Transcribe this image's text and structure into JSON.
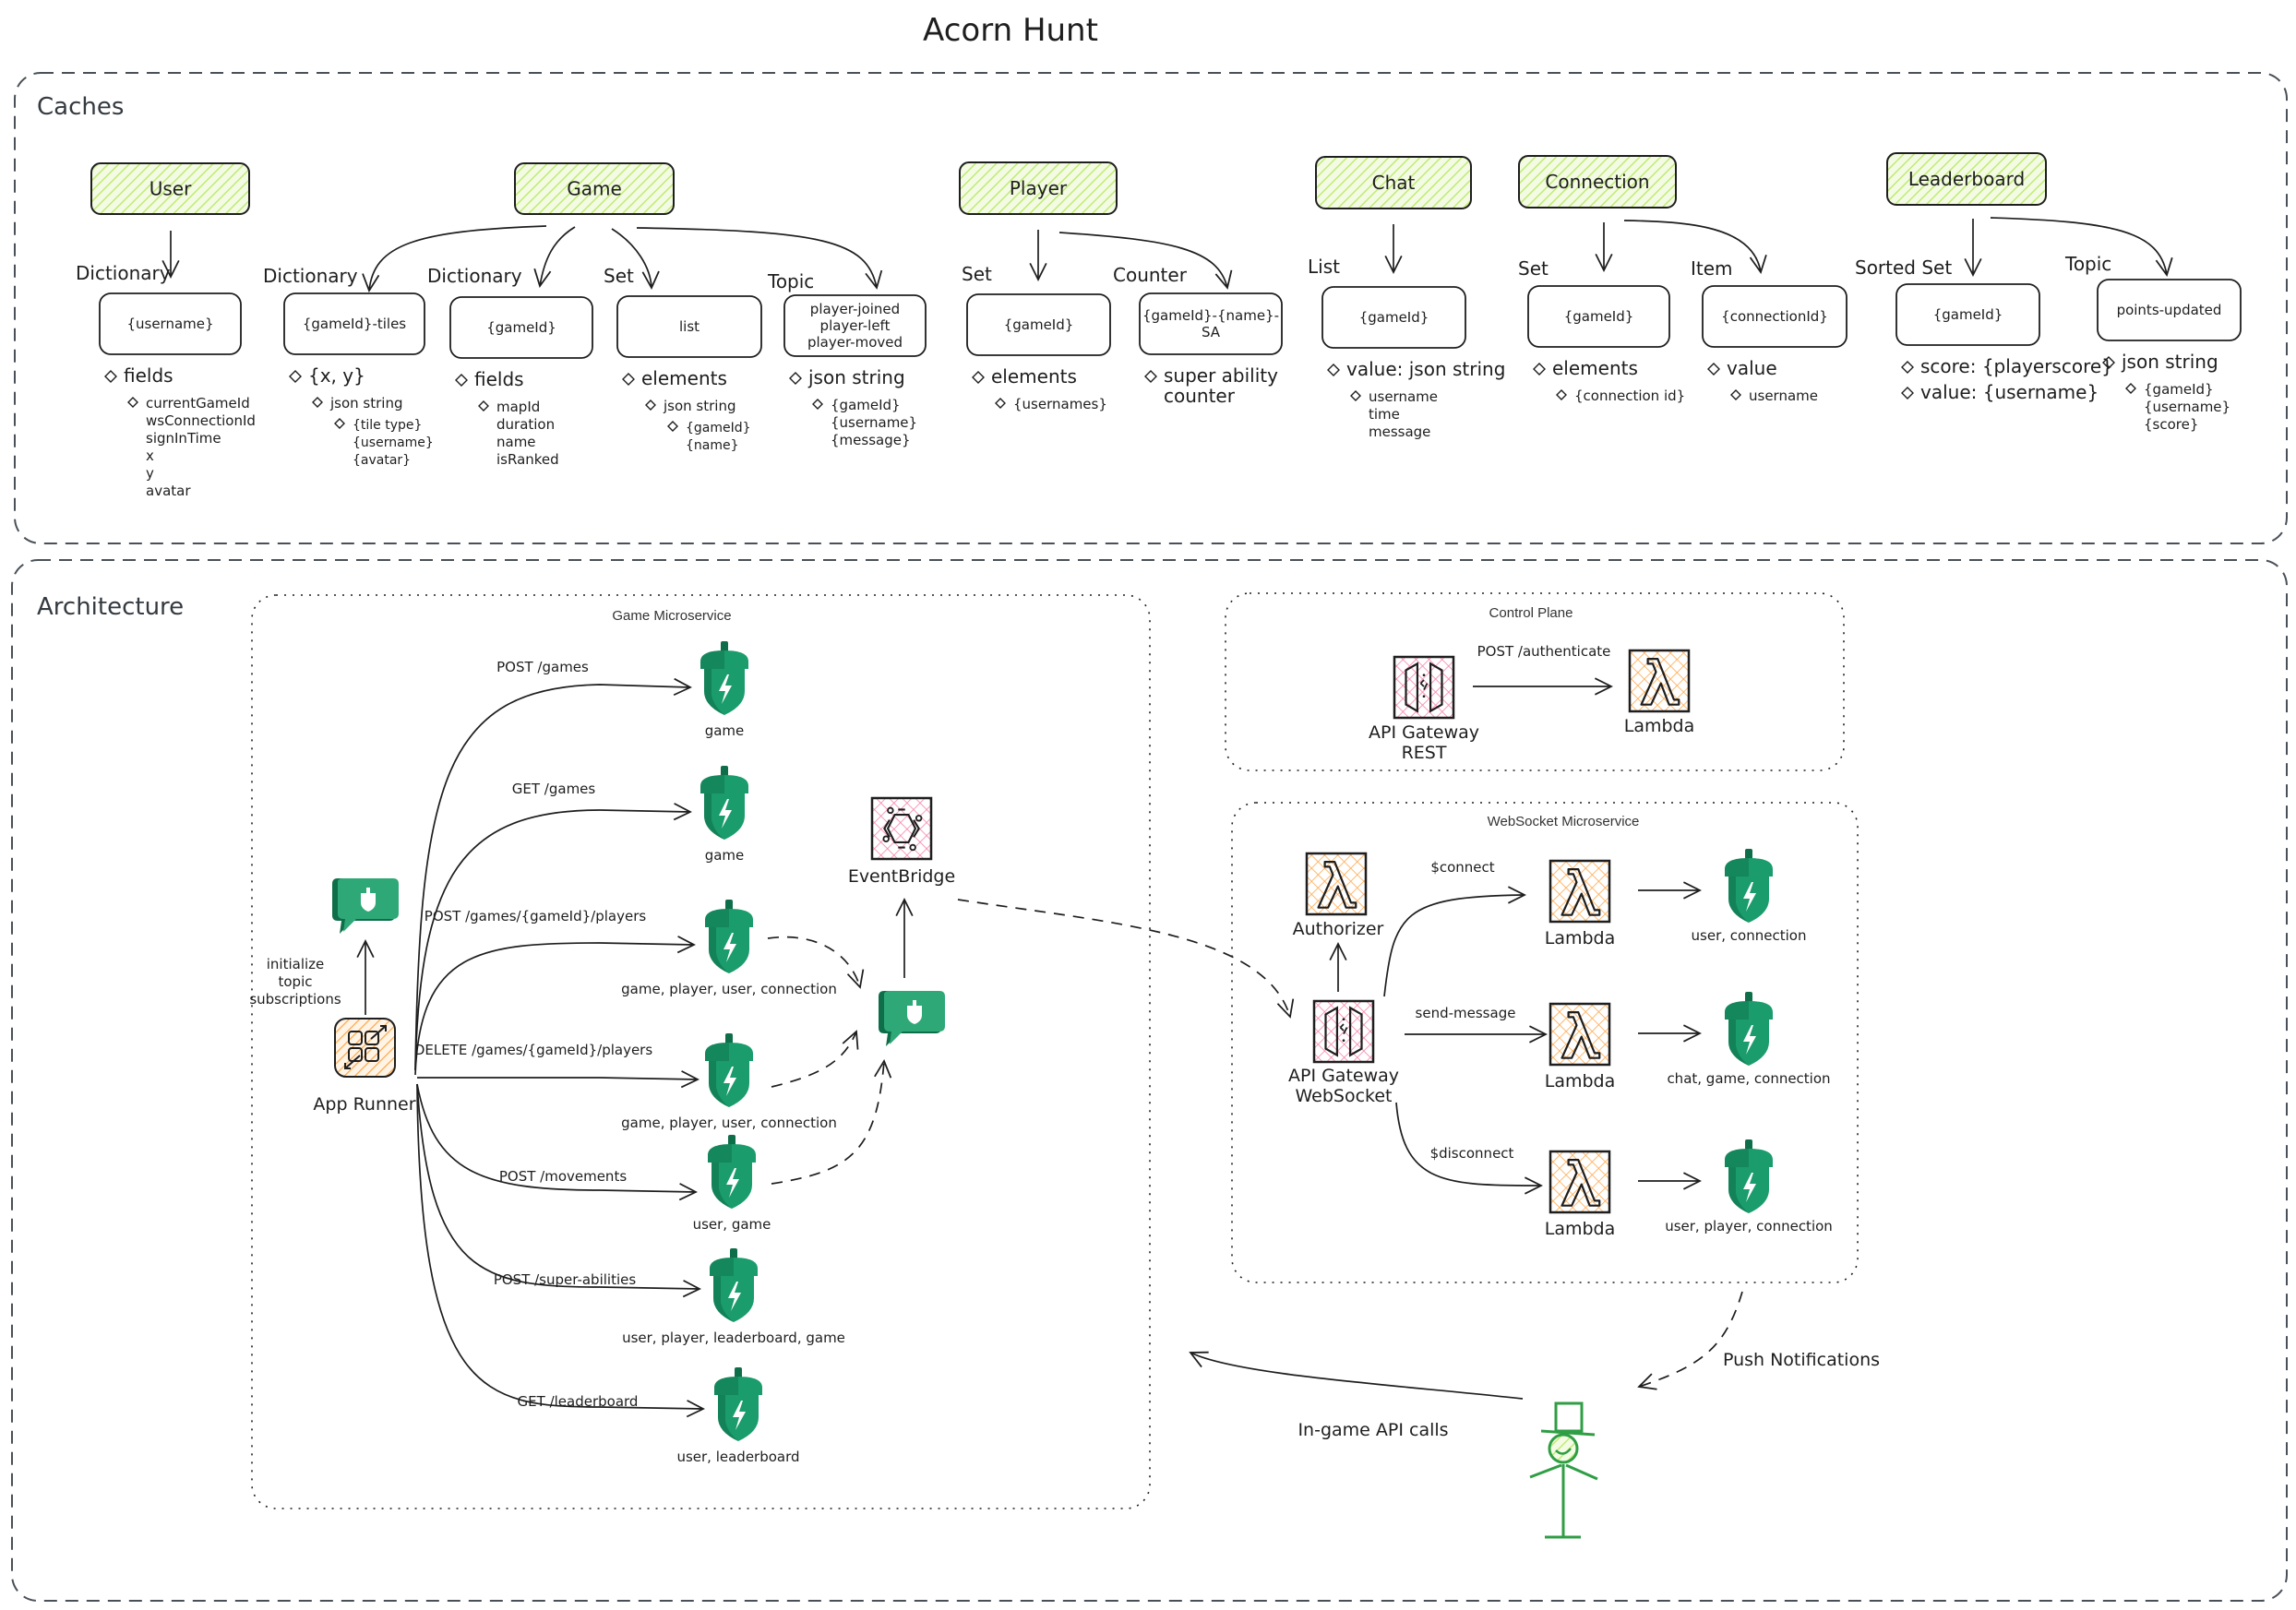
{
  "title": "Acorn Hunt",
  "caches": {
    "label": "Caches",
    "entities": [
      {
        "name": "User",
        "children": [
          {
            "type": "Dictionary",
            "key": "{username}",
            "bullets": [
              {
                "level": 1,
                "lines": [
                  "fields"
                ]
              },
              {
                "level": 2,
                "lines": [
                  "currentGameId",
                  "wsConnectionId",
                  "signInTime",
                  "x",
                  "y",
                  "avatar"
                ]
              }
            ]
          }
        ]
      },
      {
        "name": "Game",
        "children": [
          {
            "type": "Dictionary",
            "key": "{gameId}-tiles",
            "bullets": [
              {
                "level": 1,
                "lines": [
                  "{x, y}"
                ]
              },
              {
                "level": 2,
                "lines": [
                  "json string"
                ]
              },
              {
                "level": 3,
                "lines": [
                  "{tile type}",
                  "{username}",
                  "{avatar}"
                ]
              }
            ]
          },
          {
            "type": "Dictionary",
            "key": "{gameId}",
            "bullets": [
              {
                "level": 1,
                "lines": [
                  "fields"
                ]
              },
              {
                "level": 2,
                "lines": [
                  "mapId",
                  "duration",
                  "name",
                  "isRanked"
                ]
              }
            ]
          },
          {
            "type": "Set",
            "key": "list",
            "bullets": [
              {
                "level": 1,
                "lines": [
                  "elements"
                ]
              },
              {
                "level": 2,
                "lines": [
                  "json string"
                ]
              },
              {
                "level": 3,
                "lines": [
                  "{gameId}",
                  "{name}"
                ]
              }
            ]
          },
          {
            "type": "Topic",
            "key": "player-joined\nplayer-left\nplayer-moved",
            "bullets": [
              {
                "level": 1,
                "lines": [
                  "json string"
                ]
              },
              {
                "level": 2,
                "lines": [
                  "{gameId}",
                  "{username}",
                  "{message}"
                ]
              }
            ]
          }
        ]
      },
      {
        "name": "Player",
        "children": [
          {
            "type": "Set",
            "key": "{gameId}",
            "bullets": [
              {
                "level": 1,
                "lines": [
                  "elements"
                ]
              },
              {
                "level": 2,
                "lines": [
                  "{usernames}"
                ]
              }
            ]
          },
          {
            "type": "Counter",
            "key": "{gameId}-{name}-\nSA",
            "bullets": [
              {
                "level": 1,
                "lines": [
                  "super ability",
                  "counter"
                ]
              }
            ]
          }
        ]
      },
      {
        "name": "Chat",
        "children": [
          {
            "type": "List",
            "key": "{gameId}",
            "bullets": [
              {
                "level": 1,
                "lines": [
                  "value: json string"
                ]
              },
              {
                "level": 2,
                "lines": [
                  "username",
                  "time",
                  "message"
                ]
              }
            ]
          }
        ]
      },
      {
        "name": "Connection",
        "children": [
          {
            "type": "Set",
            "key": "{gameId}",
            "bullets": [
              {
                "level": 1,
                "lines": [
                  "elements"
                ]
              },
              {
                "level": 2,
                "lines": [
                  "{connection id}"
                ]
              }
            ]
          },
          {
            "type": "Item",
            "key": "{connectionId}",
            "bullets": [
              {
                "level": 1,
                "lines": [
                  "value"
                ]
              },
              {
                "level": 2,
                "lines": [
                  "username"
                ]
              }
            ]
          }
        ]
      },
      {
        "name": "Leaderboard",
        "children": [
          {
            "type": "Sorted Set",
            "key": "{gameId}",
            "bullets": [
              {
                "level": 1,
                "lines": [
                  "score: {playerscore}"
                ]
              },
              {
                "level": 1,
                "lines": [
                  "value: {username}"
                ]
              }
            ]
          },
          {
            "type": "Topic",
            "key": "points-updated",
            "bullets": [
              {
                "level": 1,
                "lines": [
                  "json string"
                ]
              },
              {
                "level": 2,
                "lines": [
                  "{gameId}",
                  "{username}",
                  "{score}"
                ]
              }
            ]
          }
        ]
      }
    ]
  },
  "architecture": {
    "label": "Architecture",
    "game_microservice": {
      "label": "Game Microservice",
      "app_runner": "App Runner",
      "topic_init_label": "initialize\ntopic\nsubscriptions",
      "routes": [
        {
          "route": "POST /games",
          "caches": "game"
        },
        {
          "route": "GET /games",
          "caches": "game"
        },
        {
          "route": "POST /games/{gameId}/players",
          "caches": "game, player, user, connection"
        },
        {
          "route": "DELETE /games/{gameId}/players",
          "caches": "game, player, user, connection"
        },
        {
          "route": "POST /movements",
          "caches": "user, game"
        },
        {
          "route": "POST /super-abilities",
          "caches": "user, player, leaderboard, game"
        },
        {
          "route": "GET /leaderboard",
          "caches": "user, leaderboard"
        }
      ],
      "eventbridge": "EventBridge"
    },
    "control_plane": {
      "label": "Control Plane",
      "gateway": "API Gateway\nREST",
      "route": "POST /authenticate",
      "lambda": "Lambda"
    },
    "websocket_microservice": {
      "label": "WebSocket Microservice",
      "authorizer": "Authorizer",
      "gateway": "API Gateway\nWebSocket",
      "routes": [
        {
          "route": "$connect",
          "lambda": "Lambda",
          "caches": "user, connection"
        },
        {
          "route": "send-message",
          "lambda": "Lambda",
          "caches": "chat, game, connection"
        },
        {
          "route": "$disconnect",
          "lambda": "Lambda",
          "caches": "user, player, connection"
        }
      ]
    },
    "client": {
      "push_label": "Push Notifications",
      "api_label": "In-game API calls"
    }
  },
  "colors": {
    "entity_fill": "#d8f5a2",
    "acorn": "#1a9c6c",
    "acorn_dark": "#0f6e4a",
    "lambda": "#f59f00",
    "gateway": "#e64980",
    "app_runner": "#fd7e14",
    "stick_figure": "#2f9e44"
  }
}
